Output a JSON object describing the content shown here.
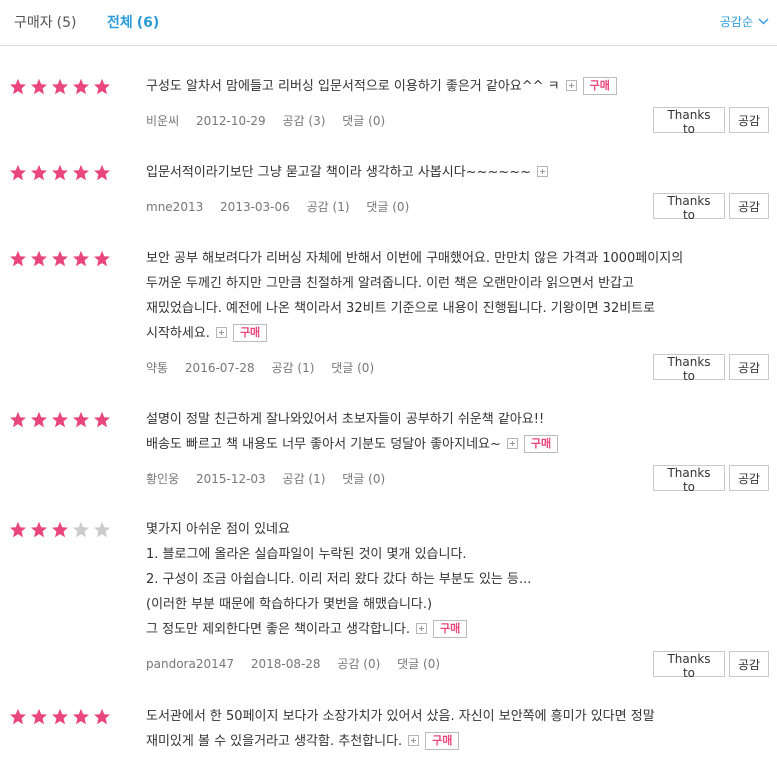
{
  "tabs": {
    "buyer": {
      "label": "구매자",
      "count": "(5)"
    },
    "all": {
      "label": "전체",
      "count": "(6)"
    },
    "sort_label": "공감순"
  },
  "colors": {
    "star_on": "#e8467c",
    "star_off": "#cccccc",
    "accent": "#2d9cdb"
  },
  "buttons": {
    "thanks": "Thanks to",
    "like": "공감"
  },
  "badge_label": "구매",
  "reviews": [
    {
      "rating": 5,
      "lines": [
        "구성도 알차서 맘에들고 리버싱 입문서적으로 이용하기 좋은거 같아요^^ ㅋ"
      ],
      "buy": true,
      "author": "비운씨",
      "date": "2012-10-29",
      "likes": "공감 (3)",
      "comments": "댓글 (0)"
    },
    {
      "rating": 5,
      "lines": [
        "입문서적이라기보단 그냥 묻고갈 책이라 생각하고 사봅시다~~~~~~"
      ],
      "buy": false,
      "author": "mne2013",
      "date": "2013-03-06",
      "likes": "공감 (1)",
      "comments": "댓글 (0)"
    },
    {
      "rating": 5,
      "lines": [
        "보안 공부 해보려다가 리버싱 자체에 반해서 이번에 구매했어요. 만만치 않은 가격과 1000페이지의",
        "두꺼운 두께긴 하지만 그만큼 친절하게 알려줍니다. 이런 책은 오랜만이라 읽으면서 반갑고",
        "재밌었습니다. 예전에 나온 책이라서 32비트 기준으로 내용이 진행됩니다. 기왕이면 32비트로",
        "시작하세요."
      ],
      "buy": true,
      "author": "약통",
      "date": "2016-07-28",
      "likes": "공감 (1)",
      "comments": "댓글 (0)"
    },
    {
      "rating": 5,
      "lines": [
        "설명이 정말 친근하게 잘나와있어서 초보자들이 공부하기 쉬운책 같아요!!",
        "배송도 빠르고 책 내용도 너무 좋아서 기분도 덩달아 좋아지네요~"
      ],
      "buy": true,
      "author": "황인웅",
      "date": "2015-12-03",
      "likes": "공감 (1)",
      "comments": "댓글 (0)"
    },
    {
      "rating": 3,
      "lines": [
        "몇가지 아쉬운 점이 있네요",
        "1. 블로그에 올라온 실습파일이 누락된 것이 몇개 있습니다.",
        "2. 구성이 조금 아쉽습니다. 이리 저리 왔다 갔다 하는 부분도 있는 등...",
        "(이러한 부분 때문에 학습하다가 몇번을 해맸습니다.)",
        "그 정도만 제외한다면 좋은 책이라고 생각합니다."
      ],
      "buy": true,
      "author": "pandora20147",
      "date": "2018-08-28",
      "likes": "공감 (0)",
      "comments": "댓글 (0)"
    },
    {
      "rating": 5,
      "lines": [
        "도서관에서 한 50페이지 보다가 소장가치가 있어서 샀음. 자신이 보안쪽에 흥미가 있다면 정말",
        "재미있게 볼 수 있을거라고 생각함. 추천합니다."
      ],
      "buy": true,
      "author": null,
      "date": null,
      "likes": null,
      "comments": null
    }
  ]
}
